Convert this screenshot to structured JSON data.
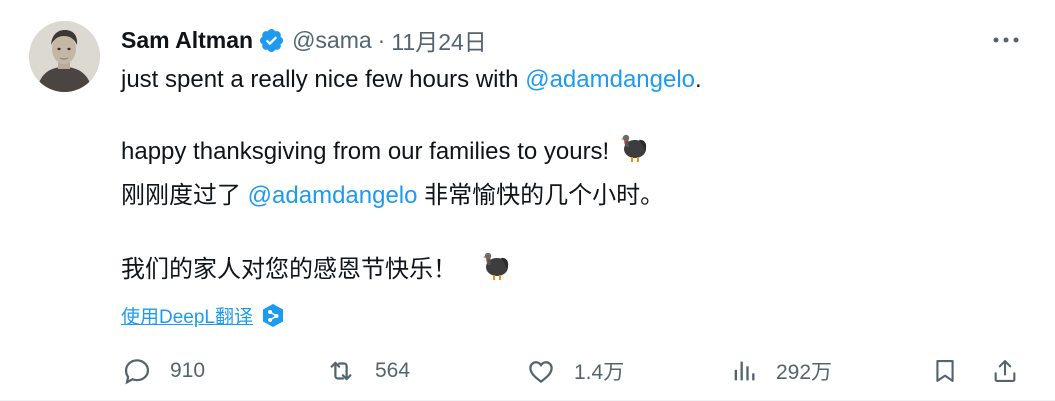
{
  "author": {
    "name": "Sam Altman",
    "handle": "@sama",
    "separator": "·",
    "date": "11月24日",
    "verified_color": "#1d9bf0"
  },
  "tweet": {
    "line1_prefix": "just spent a really nice few hours with ",
    "line1_mention": "@adamdangelo",
    "line1_suffix": ".",
    "line2": "happy thanksgiving from our families to yours!",
    "zh_line1_prefix": "刚刚度过了 ",
    "zh_line1_mention": "@adamdangelo",
    "zh_line1_suffix": " 非常愉快的几个小时。",
    "zh_line2": "我们的家人对您的感恩节快乐！",
    "emoji": "turkey-emoji"
  },
  "translate": {
    "label": "使用DeepL翻译",
    "icon": "deepl-icon"
  },
  "actions": {
    "replies": "910",
    "retweets": "564",
    "likes": "1.4万",
    "views": "292万"
  },
  "colors": {
    "accent": "#1d9bf0",
    "secondary_text": "#536471",
    "primary_text": "#0f1419"
  }
}
